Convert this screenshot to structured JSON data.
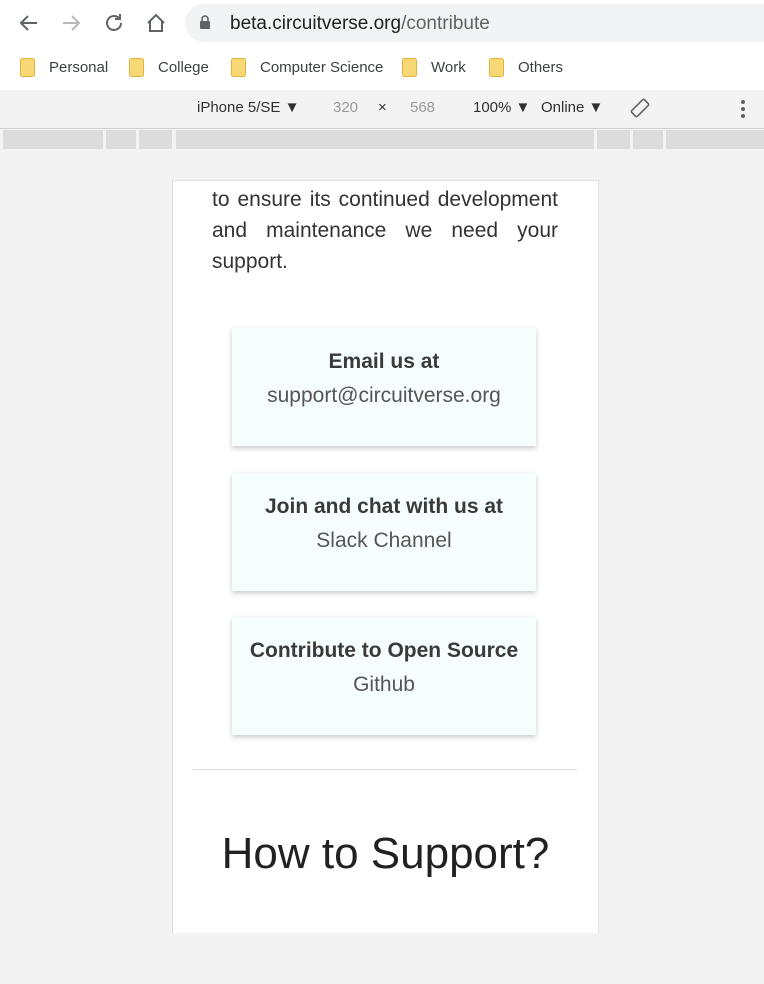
{
  "browser": {
    "url_host": "beta.circuitverse.org",
    "url_path": "/contribute"
  },
  "bookmarks": [
    {
      "label": "Personal"
    },
    {
      "label": "College"
    },
    {
      "label": "Computer Science"
    },
    {
      "label": "Work"
    },
    {
      "label": "Others"
    }
  ],
  "devtools": {
    "device": "iPhone 5/SE",
    "width": "320",
    "times": "×",
    "height": "568",
    "zoom": "100%",
    "network": "Online"
  },
  "page": {
    "intro": "to ensure its continued development and maintenance we need your support.",
    "cards": [
      {
        "title": "Email us at",
        "link": "support@circuitverse.org"
      },
      {
        "title": "Join and chat with us at",
        "link": "Slack Channel"
      },
      {
        "title": "Contribute to Open Source",
        "link": "Github"
      }
    ],
    "heading": "How to Support?"
  }
}
